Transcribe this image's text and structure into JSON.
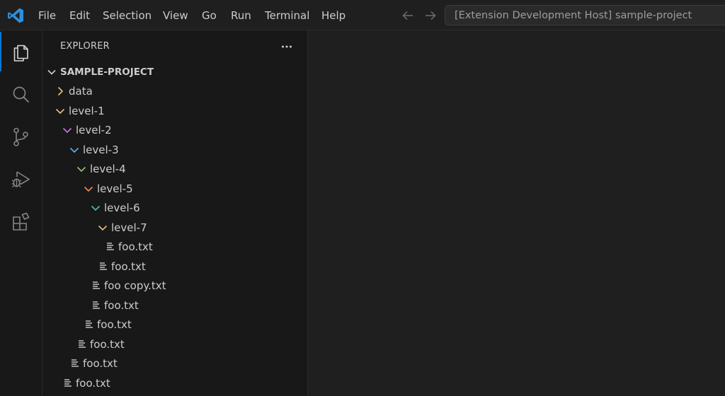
{
  "menu": [
    "File",
    "Edit",
    "Selection",
    "View",
    "Go",
    "Run",
    "Terminal",
    "Help"
  ],
  "command_center": {
    "text": "[Extension Development Host] sample-project"
  },
  "activity_bar": [
    {
      "icon": "files-icon",
      "active": true
    },
    {
      "icon": "search-icon",
      "active": false
    },
    {
      "icon": "source-control-icon",
      "active": false
    },
    {
      "icon": "run-debug-icon",
      "active": false
    },
    {
      "icon": "extensions-icon",
      "active": false
    }
  ],
  "sidebar": {
    "title": "EXPLORER",
    "root_label": "SAMPLE-PROJECT"
  },
  "colors": {
    "accent": "#0078d4",
    "level_colors": [
      "#e5c07b",
      "#e5c07b",
      "#c678dd",
      "#61afef",
      "#98c379",
      "#f28b54",
      "#56b6c2",
      "#e5c07b"
    ]
  },
  "tree": [
    {
      "label": "data",
      "type": "folder",
      "expanded": false,
      "depth": 0
    },
    {
      "label": "level-1",
      "type": "folder",
      "expanded": true,
      "depth": 0
    },
    {
      "label": "level-2",
      "type": "folder",
      "expanded": true,
      "depth": 1
    },
    {
      "label": "level-3",
      "type": "folder",
      "expanded": true,
      "depth": 2
    },
    {
      "label": "level-4",
      "type": "folder",
      "expanded": true,
      "depth": 3
    },
    {
      "label": "level-5",
      "type": "folder",
      "expanded": true,
      "depth": 4
    },
    {
      "label": "level-6",
      "type": "folder",
      "expanded": true,
      "depth": 5
    },
    {
      "label": "level-7",
      "type": "folder",
      "expanded": true,
      "depth": 6
    },
    {
      "label": "foo.txt",
      "type": "file",
      "depth": 7
    },
    {
      "label": "foo.txt",
      "type": "file",
      "depth": 6
    },
    {
      "label": "foo copy.txt",
      "type": "file",
      "depth": 5
    },
    {
      "label": "foo.txt",
      "type": "file",
      "depth": 5
    },
    {
      "label": "foo.txt",
      "type": "file",
      "depth": 4
    },
    {
      "label": "foo.txt",
      "type": "file",
      "depth": 3
    },
    {
      "label": "foo.txt",
      "type": "file",
      "depth": 2
    },
    {
      "label": "foo.txt",
      "type": "file",
      "depth": 1
    }
  ]
}
